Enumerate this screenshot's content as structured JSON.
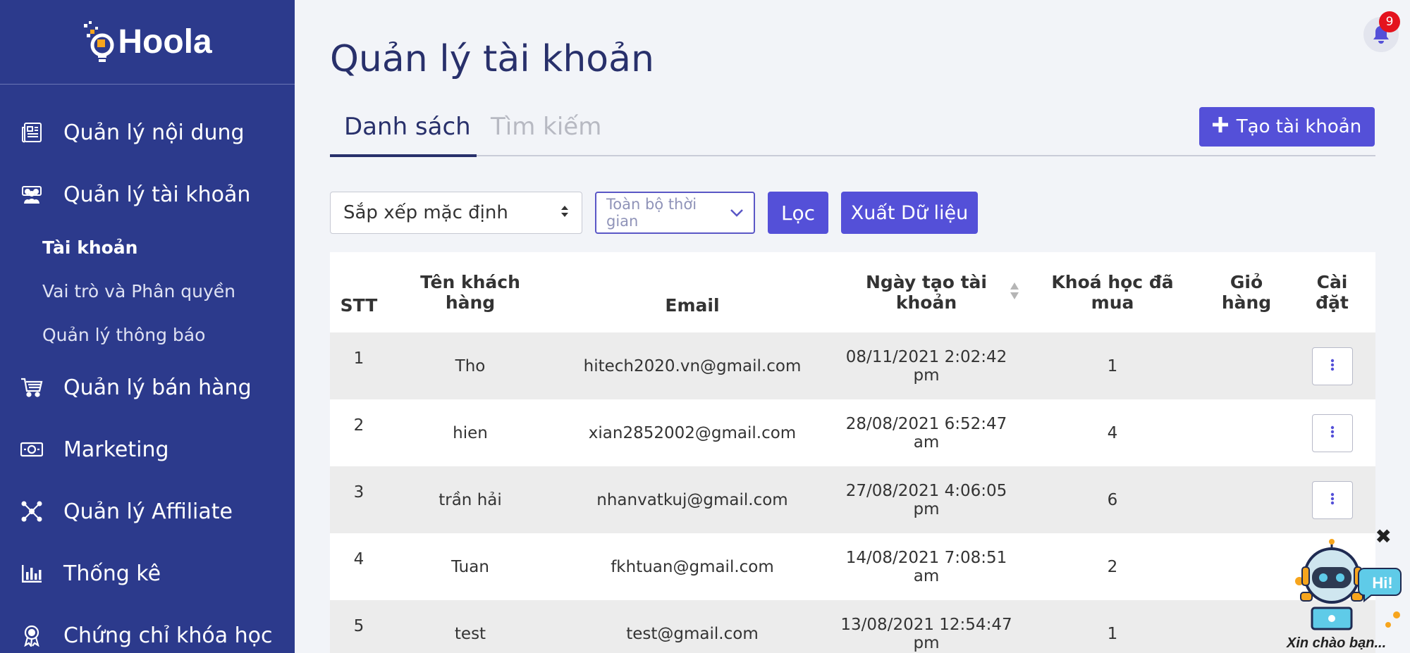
{
  "brand": {
    "name": "Hoola"
  },
  "sidebar": {
    "items": [
      {
        "label": "Quản lý nội dung",
        "icon": "newspaper-icon"
      },
      {
        "label": "Quản lý tài khoản",
        "icon": "users-icon"
      },
      {
        "label": "Quản lý bán hàng",
        "icon": "cart-icon"
      },
      {
        "label": "Marketing",
        "icon": "money-icon"
      },
      {
        "label": "Quản lý Affiliate",
        "icon": "network-icon"
      },
      {
        "label": "Thống kê",
        "icon": "bar-chart-icon"
      },
      {
        "label": "Chứng chỉ khóa học",
        "icon": "certificate-icon"
      }
    ],
    "subitems": [
      {
        "label": "Tài khoản",
        "active": true
      },
      {
        "label": "Vai trò và Phân quyền",
        "active": false
      },
      {
        "label": "Quản lý thông báo",
        "active": false
      }
    ]
  },
  "header": {
    "title": "Quản lý tài khoản",
    "notifications": "9"
  },
  "tabs": {
    "list": "Danh sách",
    "search": "Tìm kiếm"
  },
  "actions": {
    "create": "Tạo tài khoản"
  },
  "filters": {
    "sort": "Sắp xếp mặc định",
    "time": "Toàn bộ thời gian",
    "filter_btn": "Lọc",
    "export_btn": "Xuất Dữ liệu"
  },
  "table": {
    "headers": {
      "stt": "STT",
      "name_1": "Tên khách",
      "name_2": "hàng",
      "email": "Email",
      "date_1": "Ngày tạo tài",
      "date_2": "khoản",
      "course_1": "Khoá học đã",
      "course_2": "mua",
      "cart_1": "Giỏ",
      "cart_2": "hàng",
      "settings_1": "Cài",
      "settings_2": "đặt"
    },
    "rows": [
      {
        "stt": "1",
        "name": "Tho",
        "email": "hitech2020.vn@gmail.com",
        "date": "08/11/2021 2:02:42 pm",
        "courses": "1",
        "cart": ""
      },
      {
        "stt": "2",
        "name": "hien",
        "email": "xian2852002@gmail.com",
        "date": "28/08/2021 6:52:47 am",
        "courses": "4",
        "cart": ""
      },
      {
        "stt": "3",
        "name": "trần hải",
        "email": "nhanvatkuj@gmail.com",
        "date": "27/08/2021 4:06:05 pm",
        "courses": "6",
        "cart": ""
      },
      {
        "stt": "4",
        "name": "Tuan",
        "email": "fkhtuan@gmail.com",
        "date": "14/08/2021 7:08:51 am",
        "courses": "2",
        "cart": ""
      },
      {
        "stt": "5",
        "name": "test",
        "email": "test@gmail.com",
        "date": "13/08/2021 12:54:47 pm",
        "courses": "1",
        "cart": ""
      }
    ]
  },
  "chatbot": {
    "caption": "Xin chào bạn...",
    "bubble": "Hi!"
  },
  "colors": {
    "sidebar": "#2c3a8c",
    "accent": "#5450d8",
    "title": "#28306b",
    "badge": "#e4131e"
  }
}
